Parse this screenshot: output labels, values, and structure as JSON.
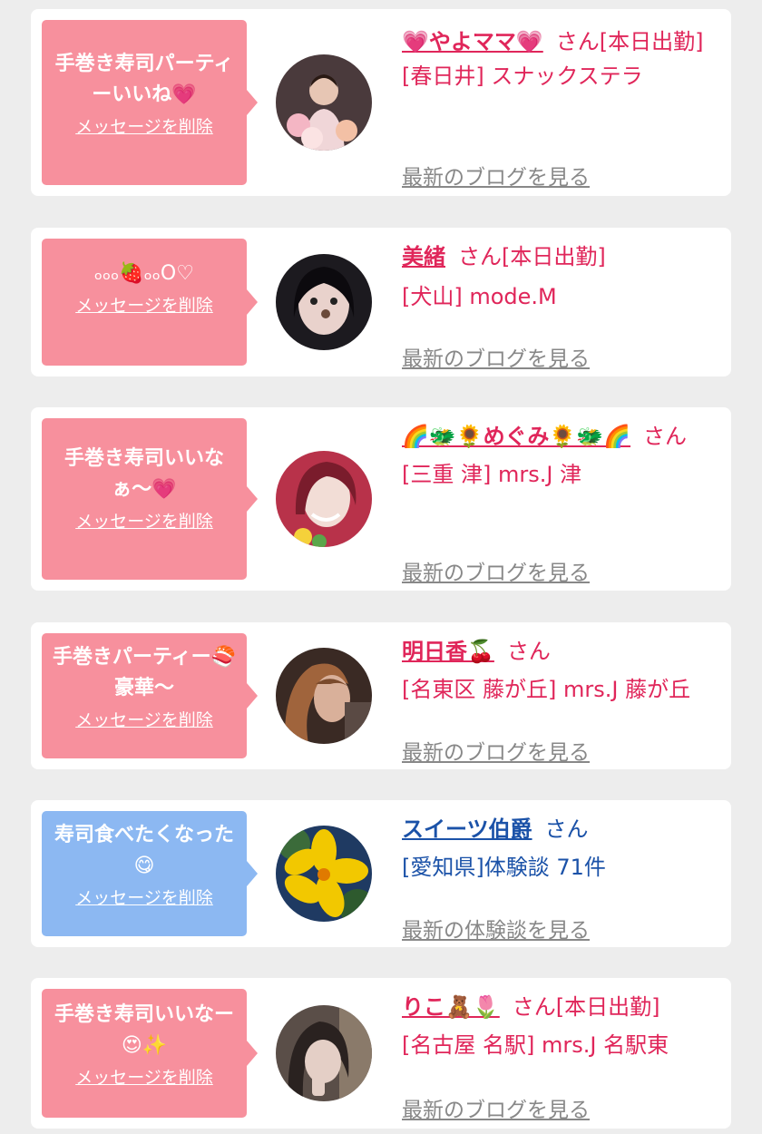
{
  "cards": [
    {
      "message": "手巻き寿司パーティーいいね💗",
      "delete_label": "メッセージを削除",
      "name": "💗やよママ💗",
      "honorific": "さん",
      "status": "[本日出勤]",
      "store": "[春日井] スナックステラ",
      "blog_link": "最新のブログを見る"
    },
    {
      "message": "ₒₒₒ🍓ₒₒO♡",
      "delete_label": "メッセージを削除",
      "name": "美緒",
      "honorific": "さん",
      "status": "[本日出勤]",
      "store": "[犬山] mode.M",
      "blog_link": "最新のブログを見る"
    },
    {
      "message": "手巻き寿司いいなぁ〜💗",
      "delete_label": "メッセージを削除",
      "name": "🌈🐲🌻めぐみ🌻🐲🌈",
      "honorific": "さん",
      "status": "",
      "store": "[三重 津] mrs.J 津",
      "blog_link": "最新のブログを見る"
    },
    {
      "message": "手巻きパーティー🍣豪華〜",
      "delete_label": "メッセージを削除",
      "name": "明日香🍒",
      "honorific": "さん",
      "status": "",
      "store": "[名東区 藤が丘] mrs.J 藤が丘",
      "blog_link": "最新のブログを見る"
    },
    {
      "message": "寿司食べたくなった😋",
      "delete_label": "メッセージを削除",
      "name": "スイーツ伯爵",
      "honorific": "さん",
      "status": "",
      "store": "[愛知県]体験談 71件",
      "blog_link": "最新の体験談を見る"
    },
    {
      "message": "手巻き寿司いいなー😍✨",
      "delete_label": "メッセージを削除",
      "name": "りこ🧸🌷",
      "honorific": "さん",
      "status": "[本日出勤]",
      "store": "[名古屋 名駅] mrs.J 名駅東",
      "blog_link": "最新のブログを見る"
    }
  ],
  "colors": {
    "pink_bubble": "#f7909d",
    "blue_bubble": "#8cb8f2",
    "pink_text": "#e0265a",
    "blue_text": "#1b52a8",
    "link_gray": "#888888"
  }
}
